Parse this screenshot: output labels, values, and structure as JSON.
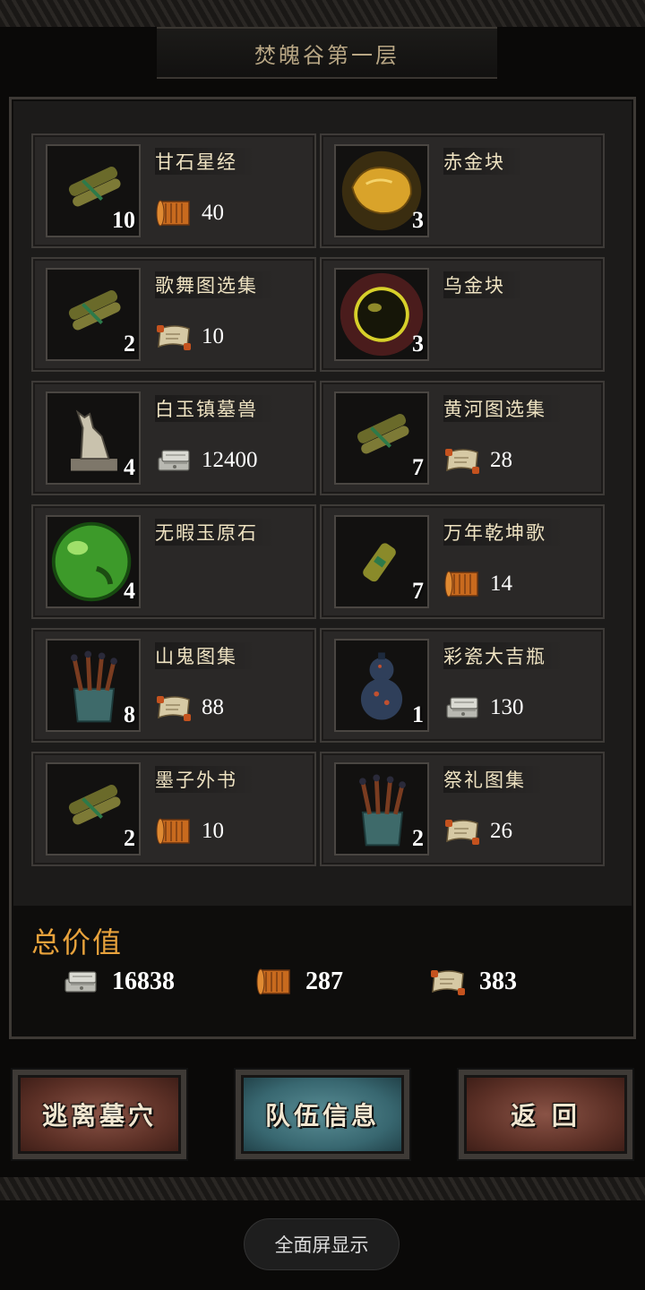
{
  "header": {
    "title": "焚魄谷第一层"
  },
  "items": [
    {
      "name": "甘石星经",
      "qty": "10",
      "price": "40",
      "currency": "scroll-icon",
      "icon": "scroll-bundle-icon"
    },
    {
      "name": "赤金块",
      "qty": "3",
      "price": "",
      "currency": "",
      "icon": "gold-nugget-icon"
    },
    {
      "name": "歌舞图选集",
      "qty": "2",
      "price": "10",
      "currency": "map-icon",
      "icon": "scroll-bundle-icon"
    },
    {
      "name": "乌金块",
      "qty": "3",
      "price": "",
      "currency": "",
      "icon": "dark-orb-icon"
    },
    {
      "name": "白玉镇墓兽",
      "qty": "4",
      "price": "12400",
      "currency": "silver-icon",
      "icon": "statue-icon"
    },
    {
      "name": "黄河图选集",
      "qty": "7",
      "price": "28",
      "currency": "map-icon",
      "icon": "scroll-bundle-icon"
    },
    {
      "name": "无暇玉原石",
      "qty": "4",
      "price": "",
      "currency": "",
      "icon": "jade-orb-icon"
    },
    {
      "name": "万年乾坤歌",
      "qty": "7",
      "price": "14",
      "currency": "scroll-icon",
      "icon": "scroll-tube-icon"
    },
    {
      "name": "山鬼图集",
      "qty": "8",
      "price": "88",
      "currency": "map-icon",
      "icon": "vase-scrolls-icon"
    },
    {
      "name": "彩瓷大吉瓶",
      "qty": "1",
      "price": "130",
      "currency": "silver-icon",
      "icon": "gourd-vase-icon"
    },
    {
      "name": "墨子外书",
      "qty": "2",
      "price": "10",
      "currency": "scroll-icon",
      "icon": "scroll-bundle-icon"
    },
    {
      "name": "祭礼图集",
      "qty": "2",
      "price": "26",
      "currency": "map-icon",
      "icon": "vase-scrolls-icon"
    }
  ],
  "totals": {
    "title": "总价值",
    "silver": "16838",
    "scroll": "287",
    "map": "383"
  },
  "buttons": {
    "escape": "逃离墓穴",
    "team": "队伍信息",
    "back": "返 回"
  },
  "system": {
    "fullscreen": "全面屏显示"
  }
}
